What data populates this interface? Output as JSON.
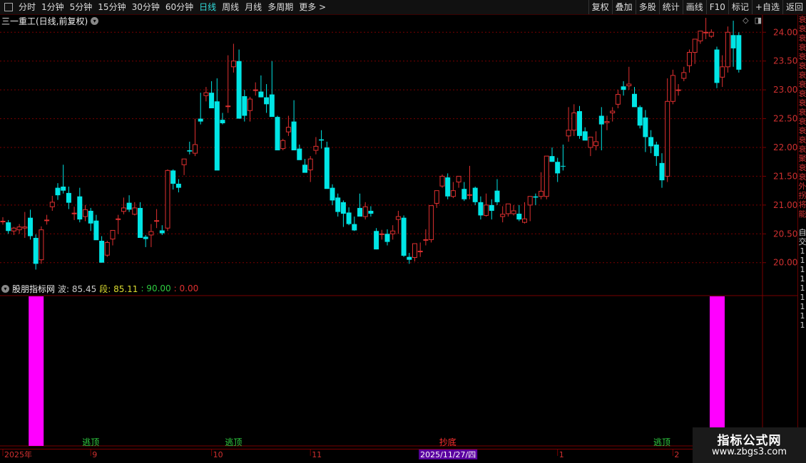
{
  "toolbar": {
    "periods": [
      "分时",
      "1分钟",
      "5分钟",
      "15分钟",
      "30分钟",
      "60分钟",
      "日线",
      "周线",
      "月线",
      "多周期",
      "更多 >"
    ],
    "active_period": "日线",
    "right_buttons": [
      "复权",
      "叠加",
      "多股",
      "统计",
      "画线",
      "F10",
      "标记",
      "+自选",
      "返回"
    ]
  },
  "title": "三一重工(日线,前复权)",
  "indicator": {
    "name": "股朋指标网",
    "wave_label": "波: 85.45",
    "seg_label": "段: 85.11",
    "v1": ": 90.00",
    "v2": ": 0.00"
  },
  "date_axis": {
    "labels": [
      "2025年",
      "9",
      "10",
      "11",
      "1",
      "2"
    ],
    "cursor_date": "2025/11/27/四"
  },
  "signals": [
    {
      "text": "逃顶",
      "color": "#2ecc40"
    },
    {
      "text": "逃顶",
      "color": "#2ecc40"
    },
    {
      "text": "抄底",
      "color": "#ff3030"
    },
    {
      "text": "逃顶",
      "color": "#2ecc40"
    }
  ],
  "right_panel_chars": [
    "衰",
    "衰",
    "衰",
    "衰",
    "衰",
    "衰",
    "衰",
    "衰",
    "衰",
    "衰",
    "衰",
    "衰",
    "衰",
    "衰",
    "衰",
    "聚",
    "衰",
    "衰",
    "外",
    "拐",
    "将",
    "能",
    "",
    "自",
    "交",
    "1",
    "1",
    "1",
    "1",
    "1",
    "1",
    "1",
    "1",
    "1"
  ],
  "watermark": {
    "line1": "指标公式网",
    "line2": "www.zbgs3.com"
  },
  "colors": {
    "up": "#e03030",
    "down": "#00e5e5",
    "bar": "#ff00ff",
    "grid": "#7a0000",
    "price_label": "#d03030"
  },
  "chart_data": {
    "type": "candlestick",
    "ylim": [
      19.7,
      24.3
    ],
    "y_ticks": [
      "24.00",
      "23.50",
      "23.00",
      "22.50",
      "22.00",
      "21.50",
      "21.00",
      "20.50",
      "20.00"
    ],
    "ohlc": [
      [
        20.72,
        20.79,
        20.66,
        20.72
      ],
      [
        20.7,
        20.74,
        20.5,
        20.55
      ],
      [
        20.55,
        20.62,
        20.48,
        20.6
      ],
      [
        20.57,
        20.67,
        20.5,
        20.62
      ],
      [
        20.6,
        20.88,
        20.43,
        20.62
      ],
      [
        20.78,
        20.92,
        20.4,
        20.46
      ],
      [
        20.43,
        20.49,
        19.88,
        19.98
      ],
      [
        20.05,
        20.63,
        19.98,
        20.57
      ],
      [
        20.74,
        20.83,
        20.66,
        20.74
      ],
      [
        20.97,
        21.16,
        20.9,
        21.05
      ],
      [
        21.3,
        21.38,
        21.09,
        21.17
      ],
      [
        21.32,
        21.7,
        21.2,
        21.25
      ],
      [
        21.21,
        21.32,
        20.93,
        21.04
      ],
      [
        20.86,
        20.97,
        20.74,
        20.86
      ],
      [
        21.15,
        21.3,
        20.7,
        20.75
      ],
      [
        20.8,
        21.0,
        20.72,
        20.92
      ],
      [
        20.9,
        20.95,
        20.55,
        20.68
      ],
      [
        20.73,
        20.83,
        20.43,
        20.39
      ],
      [
        20.38,
        20.46,
        20.0,
        20.0
      ],
      [
        20.13,
        20.38,
        20.1,
        20.35
      ],
      [
        20.41,
        20.56,
        20.3,
        20.56
      ],
      [
        20.75,
        20.83,
        20.5,
        20.76
      ],
      [
        20.89,
        21.13,
        20.84,
        20.95
      ],
      [
        21.04,
        21.17,
        20.88,
        20.92
      ],
      [
        20.84,
        21.05,
        20.82,
        20.95
      ],
      [
        20.95,
        21.05,
        20.57,
        20.43
      ],
      [
        20.45,
        20.48,
        20.27,
        20.41
      ],
      [
        20.48,
        20.67,
        20.27,
        20.54
      ],
      [
        20.73,
        20.93,
        20.6,
        20.73
      ],
      [
        20.56,
        20.65,
        20.48,
        20.51
      ],
      [
        20.6,
        21.62,
        20.55,
        21.6
      ],
      [
        21.6,
        21.62,
        21.27,
        21.37
      ],
      [
        21.37,
        21.45,
        21.22,
        21.3
      ],
      [
        21.7,
        21.8,
        21.52,
        21.8
      ],
      [
        21.95,
        22.1,
        21.88,
        21.93
      ],
      [
        21.9,
        22.5,
        21.85,
        22.05
      ],
      [
        22.5,
        22.95,
        22.4,
        22.45
      ],
      [
        22.9,
        23.05,
        22.8,
        22.95
      ],
      [
        22.95,
        23.15,
        22.92,
        22.68
      ],
      [
        22.8,
        23.2,
        22.3,
        21.6
      ],
      [
        22.48,
        22.6,
        22.4,
        22.42
      ],
      [
        22.72,
        23.6,
        22.6,
        22.72
      ],
      [
        23.4,
        23.8,
        23.3,
        23.5
      ],
      [
        23.5,
        23.7,
        23.12,
        22.5
      ],
      [
        22.89,
        23.0,
        22.45,
        22.55
      ],
      [
        22.64,
        22.88,
        22.45,
        22.84
      ],
      [
        22.99,
        23.13,
        22.9,
        23.0
      ],
      [
        22.97,
        23.25,
        22.87,
        22.87
      ],
      [
        22.87,
        23.1,
        22.6,
        22.75
      ],
      [
        22.92,
        23.5,
        22.75,
        22.53
      ],
      [
        22.53,
        22.55,
        22.0,
        21.95
      ],
      [
        21.98,
        22.15,
        21.95,
        22.12
      ],
      [
        22.27,
        22.55,
        22.2,
        22.35
      ],
      [
        22.45,
        22.82,
        22.2,
        21.95
      ],
      [
        21.98,
        22.05,
        21.8,
        21.78
      ],
      [
        21.7,
        21.8,
        21.6,
        21.56
      ],
      [
        21.61,
        21.85,
        21.4,
        21.8
      ],
      [
        21.95,
        22.18,
        21.88,
        22.02
      ],
      [
        22.14,
        22.3,
        21.98,
        22.12
      ],
      [
        22.0,
        22.1,
        21.8,
        21.28
      ],
      [
        21.3,
        21.36,
        21.0,
        21.08
      ],
      [
        21.13,
        21.2,
        20.8,
        20.88
      ],
      [
        21.05,
        21.08,
        20.62,
        20.85
      ],
      [
        20.87,
        20.96,
        20.65,
        20.67
      ],
      [
        20.67,
        20.8,
        20.55,
        20.56
      ],
      [
        20.95,
        21.2,
        20.8,
        20.8
      ],
      [
        20.8,
        21.05,
        20.75,
        20.97
      ],
      [
        20.9,
        20.98,
        20.8,
        20.85
      ],
      [
        20.55,
        20.6,
        20.23,
        20.23
      ],
      [
        20.5,
        20.57,
        20.4,
        20.5
      ],
      [
        20.5,
        20.58,
        20.3,
        20.36
      ],
      [
        20.5,
        20.65,
        20.4,
        20.55
      ],
      [
        20.75,
        20.9,
        20.5,
        20.8
      ],
      [
        20.78,
        20.82,
        20.1,
        20.12
      ],
      [
        20.1,
        20.17,
        19.98,
        20.05
      ],
      [
        20.09,
        20.28,
        20.02,
        20.33
      ],
      [
        20.19,
        20.35,
        20.1,
        20.2
      ],
      [
        20.4,
        20.58,
        20.3,
        20.4
      ],
      [
        20.4,
        20.75,
        20.35,
        20.99
      ],
      [
        21.03,
        21.17,
        20.95,
        21.25
      ],
      [
        21.33,
        21.53,
        21.3,
        21.5
      ],
      [
        21.48,
        21.55,
        21.1,
        21.15
      ],
      [
        21.15,
        21.4,
        21.12,
        21.25
      ],
      [
        21.4,
        21.5,
        21.3,
        21.5
      ],
      [
        21.28,
        21.4,
        21.07,
        21.1
      ],
      [
        21.18,
        21.68,
        21.1,
        21.18
      ],
      [
        21.3,
        21.32,
        21.0,
        21.05
      ],
      [
        21.05,
        21.15,
        20.75,
        20.82
      ],
      [
        20.82,
        21.2,
        20.8,
        21.0
      ],
      [
        21.0,
        21.1,
        20.75,
        20.9
      ],
      [
        21.25,
        21.45,
        21.0,
        21.05
      ],
      [
        20.8,
        20.98,
        20.7,
        20.84
      ],
      [
        20.85,
        21.02,
        20.8,
        21.02
      ],
      [
        20.85,
        21.0,
        20.82,
        20.9
      ],
      [
        20.85,
        21.0,
        20.72,
        20.75
      ],
      [
        20.7,
        21.05,
        20.68,
        20.76
      ],
      [
        21.0,
        21.15,
        20.72,
        21.15
      ],
      [
        21.15,
        21.2,
        21.0,
        21.13
      ],
      [
        21.15,
        21.57,
        21.1,
        21.24
      ],
      [
        21.15,
        21.85,
        21.1,
        21.85
      ],
      [
        21.85,
        22.0,
        21.75,
        21.75
      ],
      [
        21.75,
        21.82,
        21.4,
        21.55
      ],
      [
        21.68,
        22.05,
        21.6,
        21.67
      ],
      [
        22.2,
        22.7,
        22.1,
        22.3
      ],
      [
        22.3,
        22.75,
        22.2,
        22.6
      ],
      [
        22.63,
        22.72,
        22.15,
        22.2
      ],
      [
        22.28,
        22.35,
        22.15,
        22.12
      ],
      [
        22.0,
        22.15,
        21.85,
        22.18
      ],
      [
        22.03,
        22.28,
        21.95,
        22.1
      ],
      [
        22.55,
        22.7,
        21.95,
        22.4
      ],
      [
        22.43,
        22.55,
        22.3,
        22.45
      ],
      [
        22.6,
        22.7,
        22.45,
        22.63
      ],
      [
        22.75,
        23.0,
        22.68,
        22.92
      ],
      [
        23.06,
        23.15,
        22.9,
        23.0
      ],
      [
        23.07,
        23.4,
        23.0,
        23.1
      ],
      [
        22.93,
        23.05,
        22.7,
        22.7
      ],
      [
        22.7,
        22.73,
        22.33,
        22.38
      ],
      [
        22.52,
        22.65,
        21.92,
        22.18
      ],
      [
        22.18,
        22.3,
        21.9,
        22.02
      ],
      [
        22.05,
        22.1,
        21.68,
        21.85
      ],
      [
        21.73,
        21.9,
        21.3,
        21.43
      ],
      [
        21.5,
        23.2,
        21.4,
        22.8
      ],
      [
        22.8,
        23.35,
        22.75,
        23.25
      ],
      [
        23.0,
        23.1,
        22.9,
        23.0
      ],
      [
        23.2,
        23.4,
        23.15,
        23.3
      ],
      [
        23.42,
        23.7,
        23.3,
        23.65
      ],
      [
        23.65,
        23.8,
        23.45,
        23.88
      ],
      [
        23.85,
        23.95,
        23.8,
        24.02
      ],
      [
        24.0,
        24.25,
        23.88,
        24.0
      ],
      [
        23.93,
        24.05,
        23.9,
        24.0
      ],
      [
        23.7,
        23.75,
        23.03,
        23.12
      ],
      [
        23.22,
        23.6,
        23.05,
        23.4
      ],
      [
        23.4,
        24.1,
        23.3,
        24.0
      ],
      [
        23.95,
        24.2,
        23.4,
        23.72
      ],
      [
        23.95,
        24.0,
        23.3,
        23.35
      ]
    ],
    "indicator_bars": [
      {
        "index": 6,
        "value": 90.0
      },
      {
        "index": 130,
        "value": 90.0
      }
    ]
  }
}
